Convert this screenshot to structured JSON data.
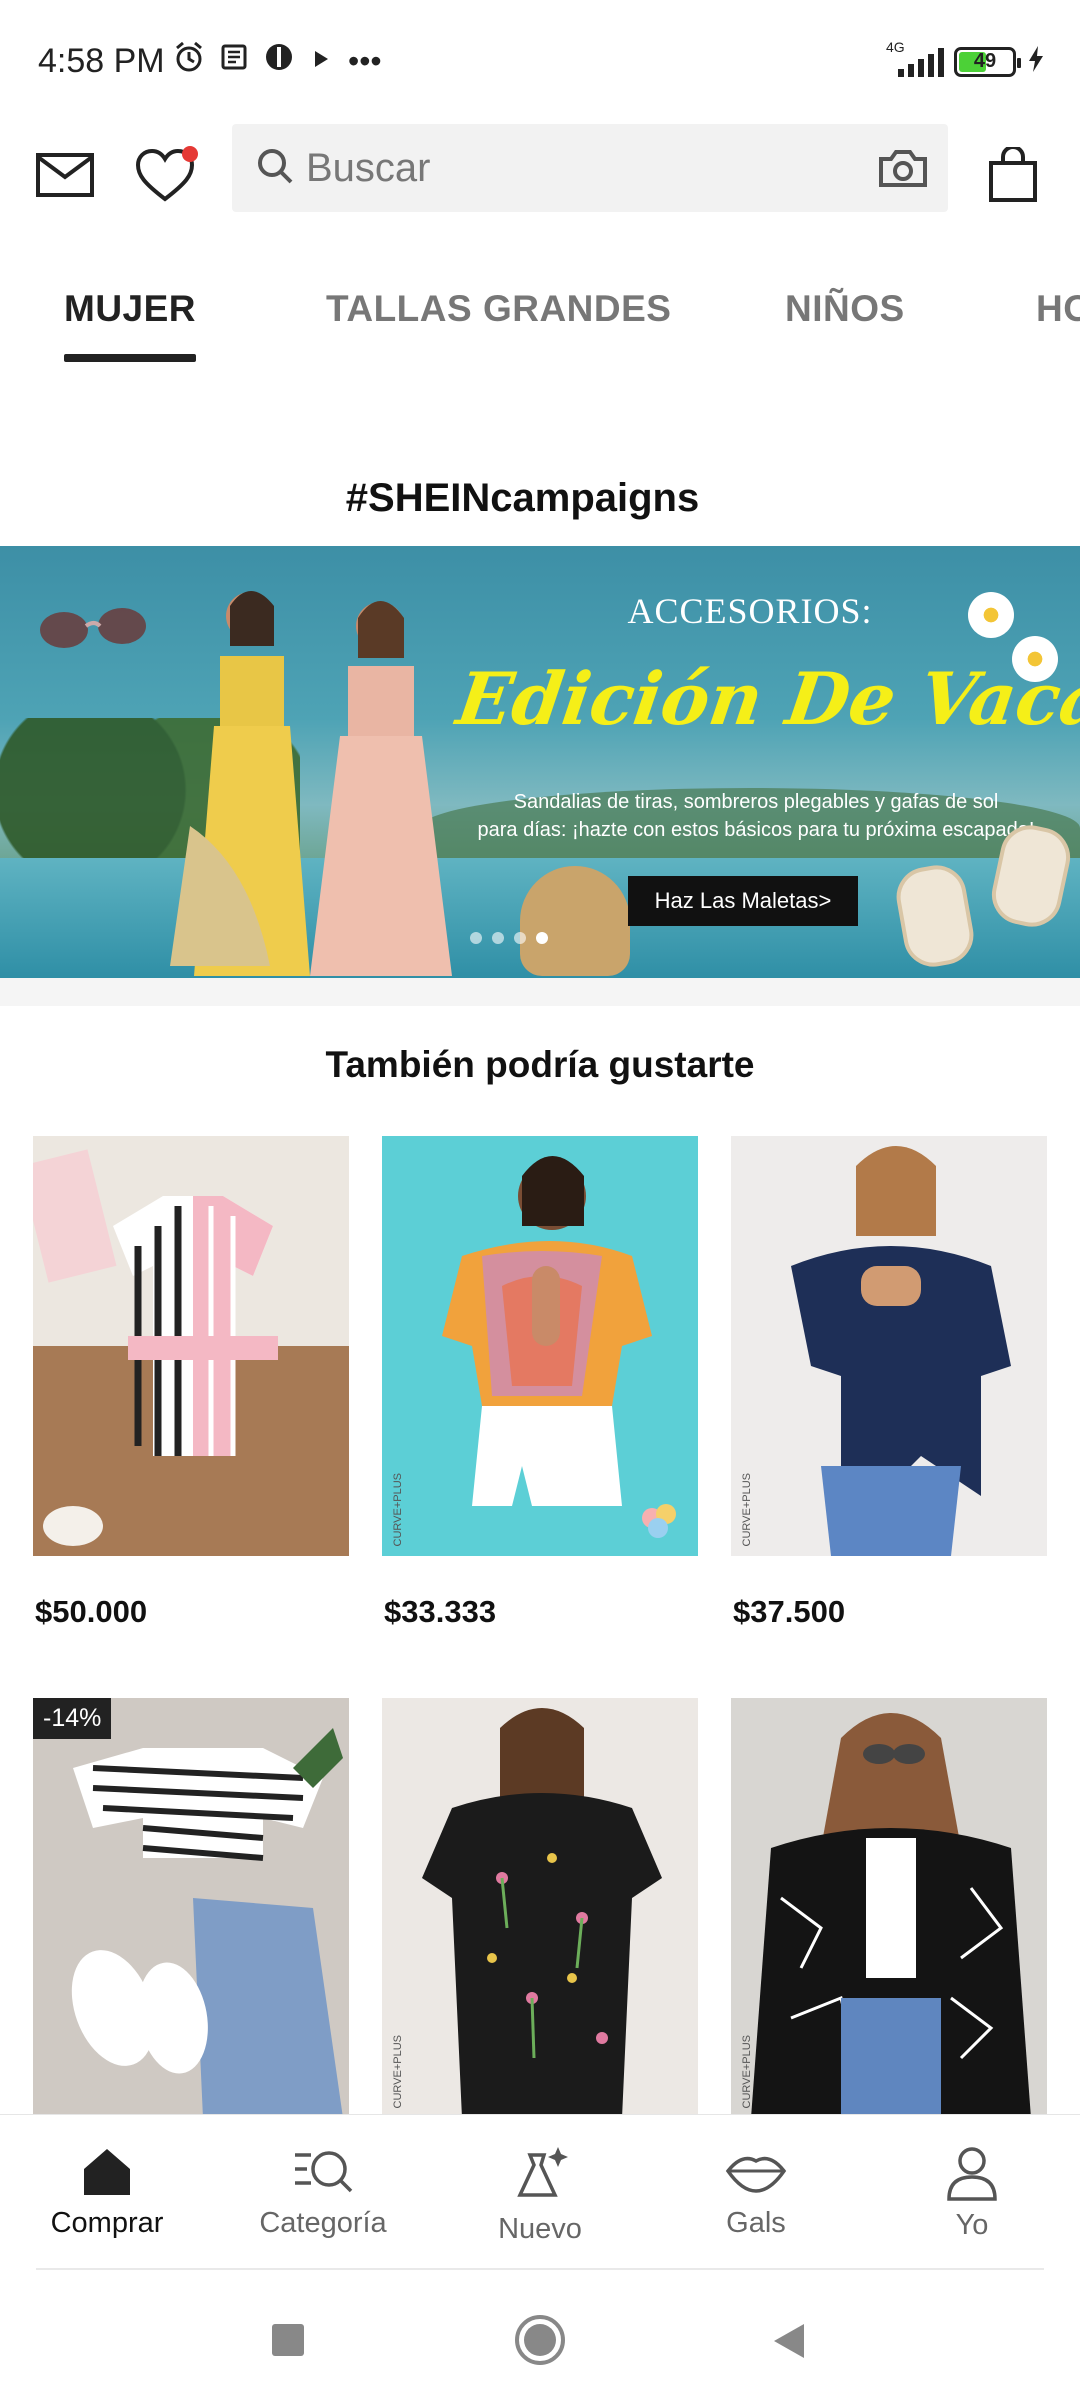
{
  "status_bar": {
    "time": "4:58 PM",
    "more": "•••",
    "network": "4G",
    "battery": "49"
  },
  "header": {
    "search_placeholder": "Buscar",
    "icons": [
      "mail-icon",
      "heart-icon",
      "search-icon",
      "camera-icon",
      "bag-icon"
    ],
    "wishlist_dot_color": "#e53935"
  },
  "tabs": [
    {
      "label": "MUJER",
      "active": true
    },
    {
      "label": "TALLAS GRANDES",
      "active": false
    },
    {
      "label": "NIÑOS",
      "active": false
    },
    {
      "label": "HO",
      "active": false
    }
  ],
  "campaign": {
    "title": "#SHEINcampaigns",
    "banner": {
      "heading": "ACCESORIOS:",
      "script_title": "Edición De Vacaciones",
      "subtitle_line1": "Sandalias de tiras, sombreros plegables y gafas de sol",
      "subtitle_line2": "para días: ¡hazte con estos básicos para tu próxima escapada!",
      "cta": "Haz Las Maletas>",
      "slide_count": 4,
      "active_slide": 4
    }
  },
  "recommendations": {
    "title": "También podría gustarte",
    "products": [
      {
        "price": "$50.000",
        "badge": "",
        "curve_label": ""
      },
      {
        "price": "$33.333",
        "badge": "",
        "curve_label": "CURVE+PLUS"
      },
      {
        "price": "$37.500",
        "badge": "",
        "curve_label": "CURVE+PLUS"
      },
      {
        "price": "",
        "badge": "-14%",
        "curve_label": ""
      },
      {
        "price": "",
        "badge": "",
        "curve_label": "CURVE+PLUS"
      },
      {
        "price": "",
        "badge": "",
        "curve_label": "CURVE+PLUS"
      }
    ]
  },
  "bottom_nav": [
    {
      "label": "Comprar",
      "icon": "home-icon",
      "active": true
    },
    {
      "label": "Categoría",
      "icon": "category-search-icon",
      "active": false
    },
    {
      "label": "Nuevo",
      "icon": "new-dress-icon",
      "active": false
    },
    {
      "label": "Gals",
      "icon": "lips-icon",
      "active": false
    },
    {
      "label": "Yo",
      "icon": "user-icon",
      "active": false
    }
  ],
  "colors": {
    "accent": "#222222",
    "banner_script": "#f5ef18",
    "battery_fill": "#4cd137"
  }
}
